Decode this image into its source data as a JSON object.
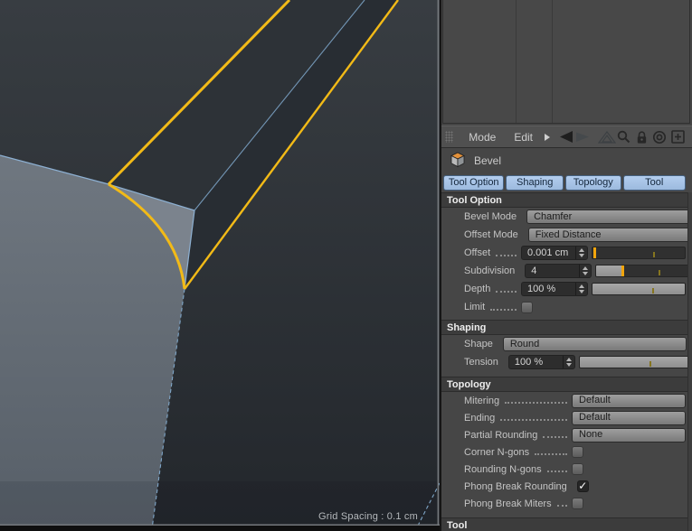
{
  "colors": {
    "edge_yellow": "#f2ba17",
    "edge_blue": "#8db0d2",
    "dashed_blue": "#7fa6c8",
    "viewport_bg_top": "#383d42",
    "viewport_bg_bottom": "#23272c",
    "bevel_strip": "#2d3237",
    "bevel_strip_dark": "#282d33",
    "selected_face_top": "#6f7780",
    "selected_face_bottom": "#575f68",
    "corner_face": "#7b838d",
    "panel_bg": "#464646",
    "tab_blue": "#a6c2e6",
    "slider_handle": "#f2a50c",
    "slider_tick": "#86751f"
  },
  "viewport": {
    "grid_spacing_label": "Grid Spacing : 0.1 cm"
  },
  "am": {
    "toolbar": {
      "mode_label": "Mode",
      "edit_label": "Edit",
      "icons": [
        "panel-grip",
        "expand-arrow",
        "history-back",
        "history-forward",
        "navigate-up",
        "search",
        "lock",
        "focus-target",
        "add-panel"
      ]
    },
    "title": {
      "icon": "bevel-cube-icon",
      "label": "Bevel"
    },
    "tabs": [
      {
        "label": "Tool Option",
        "selected": true
      },
      {
        "label": "Shaping",
        "selected": true
      },
      {
        "label": "Topology",
        "selected": true
      },
      {
        "label": "Tool",
        "selected": true
      }
    ],
    "tool_option": {
      "header": "Tool Option",
      "bevel_mode": {
        "label": "Bevel Mode",
        "value": "Chamfer"
      },
      "offset_mode": {
        "label": "Offset Mode",
        "value": "Fixed Distance"
      },
      "offset": {
        "label": "Offset",
        "value": "0.001 cm",
        "slider": {
          "fill": "0%",
          "handle": "0.5%",
          "tick": "66%"
        }
      },
      "subdivision": {
        "label": "Subdivision",
        "value": "4",
        "slider": {
          "fill": "27%",
          "handle": "27%",
          "tick": "67%"
        }
      },
      "depth": {
        "label": "Depth",
        "value": "100 %",
        "slider": {
          "fill": "100%",
          "tick": "65%"
        }
      },
      "limit": {
        "label": "Limit",
        "checked": false,
        "mark": ""
      }
    },
    "shaping": {
      "header": "Shaping",
      "shape": {
        "label": "Shape",
        "value": "Round"
      },
      "tension": {
        "label": "Tension",
        "value": "100 %",
        "slider": {
          "fill": "100%",
          "tick": "63%"
        }
      }
    },
    "topology": {
      "header": "Topology",
      "mitering": {
        "label": "Mitering",
        "value": "Default"
      },
      "ending": {
        "label": "Ending",
        "value": "Default"
      },
      "partial_rounding": {
        "label": "Partial Rounding",
        "value": "None"
      },
      "corner_ngons": {
        "label": "Corner N-gons",
        "checked": false,
        "mark": ""
      },
      "rounding_ngons": {
        "label": "Rounding N-gons",
        "checked": false,
        "mark": ""
      },
      "phong_break_rounding": {
        "label": "Phong Break Rounding",
        "checked": true,
        "mark": "✓"
      },
      "phong_break_miters": {
        "label": "Phong Break Miters",
        "checked": false,
        "mark": ""
      }
    },
    "tool_section": {
      "header": "Tool"
    }
  }
}
